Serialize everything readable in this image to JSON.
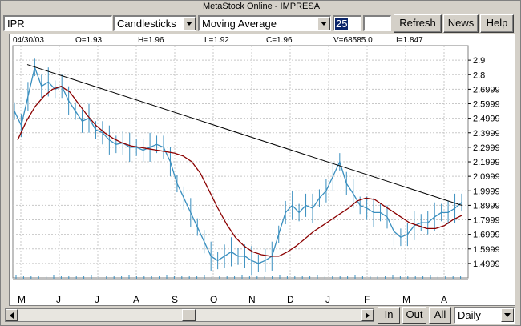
{
  "window": {
    "title": "MetaStock Online - IMPRESA"
  },
  "toolbar": {
    "symbol_value": "IPR",
    "chart_type": "Candlesticks",
    "indicator": "Moving Average",
    "period_value": "25",
    "refresh_label": "Refresh",
    "news_label": "News",
    "help_label": "Help"
  },
  "quote": {
    "date": "04/30/03",
    "open": "O=1.93",
    "high": "H=1.96",
    "low": "L=1.92",
    "close": "C=1.96",
    "volume": "V=68585.0",
    "indicator": "I=1.847"
  },
  "bottom": {
    "in_label": "In",
    "out_label": "Out",
    "all_label": "All",
    "interval": "Daily"
  },
  "colors": {
    "price": "#3a8fbf",
    "moving_average": "#8b0000",
    "trendline": "#000000"
  },
  "chart_data": {
    "type": "line",
    "title": "",
    "y_ticks": [
      "2.9",
      "2.8",
      "2.6999",
      "2.5999",
      "2.4999",
      "2.3999",
      "2.2999",
      "2.1999",
      "2.0999",
      "1.9999",
      "1.8999",
      "1.7999",
      "1.6999",
      "1.5999",
      "1.4999"
    ],
    "x_ticks": [
      "M",
      "J",
      "J",
      "A",
      "S",
      "O",
      "N",
      "D",
      "J",
      "F",
      "M",
      "A"
    ],
    "ylim": [
      1.4,
      3.0
    ],
    "grid": true,
    "series": [
      {
        "values": [
          2.55,
          2.45,
          2.65,
          2.85,
          2.72,
          2.75,
          2.7,
          2.72,
          2.62,
          2.55,
          2.48,
          2.5,
          2.42,
          2.4,
          2.35,
          2.32,
          2.33,
          2.3,
          2.3,
          2.28,
          2.3,
          2.32,
          2.3,
          2.2,
          2.05,
          1.95,
          1.85,
          1.75,
          1.65,
          1.55,
          1.52,
          1.55,
          1.58,
          1.55,
          1.55,
          1.52,
          1.5,
          1.52,
          1.55,
          1.7,
          1.85,
          1.9,
          1.85,
          1.9,
          1.88,
          1.95,
          2.0,
          2.1,
          2.2,
          2.05,
          1.98,
          1.9,
          1.88,
          1.85,
          1.85,
          1.82,
          1.72,
          1.68,
          1.7,
          1.76,
          1.78,
          1.78,
          1.82,
          1.85,
          1.85,
          1.88,
          1.92
        ]
      },
      {
        "values": [
          2.35,
          2.48,
          2.58,
          2.65,
          2.7,
          2.72,
          2.68,
          2.6,
          2.52,
          2.45,
          2.4,
          2.36,
          2.33,
          2.31,
          2.3,
          2.29,
          2.28,
          2.27,
          2.26,
          2.24,
          2.2,
          2.12,
          2.0,
          1.88,
          1.77,
          1.68,
          1.62,
          1.58,
          1.56,
          1.55,
          1.55,
          1.58,
          1.62,
          1.67,
          1.72,
          1.76,
          1.8,
          1.84,
          1.88,
          1.93,
          1.95,
          1.94,
          1.9,
          1.86,
          1.82,
          1.78,
          1.76,
          1.74,
          1.74,
          1.76,
          1.8,
          1.83
        ]
      }
    ],
    "trendline": {
      "from": 2.87,
      "to": 1.9
    }
  }
}
